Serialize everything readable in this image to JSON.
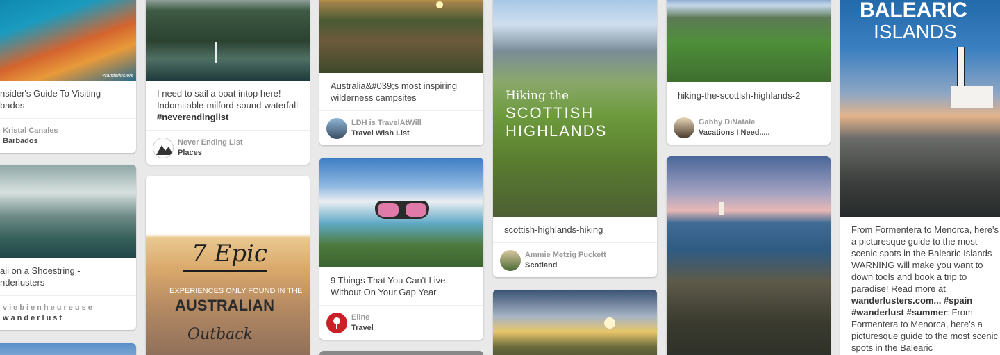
{
  "pins": {
    "p1": {
      "desc": "nsider's Guide To Visiting\nbados",
      "user": "Kristal Canales",
      "board": "Barbados"
    },
    "p2": {
      "desc": "aii on a Shoestring -\nnderlusters",
      "user": "viebienheureuse",
      "board": "wanderlust"
    },
    "p3": {
      "desc": "I need to sail a boat intop here! Indomitable-milford-sound-waterfall",
      "tag": "#neverendinglist",
      "user": "Never Ending List",
      "board": "Places"
    },
    "p4": {
      "img_title": "7 Epic",
      "img_sub": "EXPERIENCES ONLY FOUND IN THE",
      "img_main": "AUSTRALIAN",
      "img_script": "Outback"
    },
    "p5": {
      "desc": "Australia&#039;s most inspiring wilderness campsites",
      "user": "LDH is TravelAtWill",
      "board": "Travel Wish List"
    },
    "p6": {
      "desc": "9 Things That You Can't Live Without On Your Gap Year",
      "user": "Eline",
      "board": "Travel"
    },
    "p7": {
      "img_line1": "Hiking the",
      "img_line2": "SCOTTISH",
      "img_line3": "HIGHLANDS",
      "desc": "scottish-highlands-hiking",
      "user": "Ammie Metzig Puckett",
      "board": "Scotland"
    },
    "p8": {
      "desc": "hiking-the-scottish-highlands-2",
      "user": "Gabby DiNatale",
      "board": "Vacations I Need....."
    },
    "p9": {
      "img_title": "BALEARIC",
      "img_sub": "ISLANDS",
      "desc1": "From Formentera to Menorca, here's a picturesque guide to the most scenic spots in the Balearic Islands - WARNING will make you want to down tools and book a trip to paradise! Read more at ",
      "desc_bold": "wanderlusters.com... #spain #wanderlust #summer",
      "desc2": ": From Formentera to Menorca, here's a picturesque guide to the most scenic spots in the Balearic"
    }
  },
  "watermark": "Wanderlusters",
  "colors": {
    "background": "#e9e9e9",
    "card": "#ffffff",
    "pin_red": "#cb2027"
  }
}
